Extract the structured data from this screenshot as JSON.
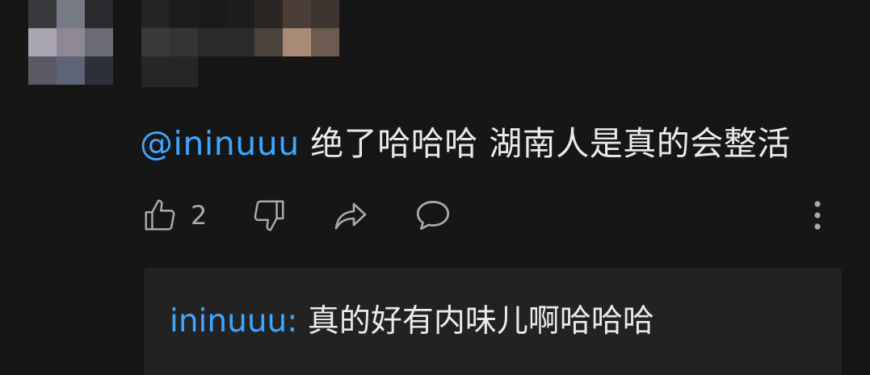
{
  "comment": {
    "author_mosaic": "blurred",
    "mention": "@ininuuu",
    "text": "绝了哈哈哈 湖南人是真的会整活",
    "likes": "2",
    "icons": {
      "like": "thumbs-up-icon",
      "dislike": "thumbs-down-icon",
      "share": "share-icon",
      "reply": "reply-bubble-icon",
      "more": "more-vertical-icon"
    }
  },
  "reply_preview": {
    "author": "ininuuu:",
    "text": "真的好有内味儿啊哈哈哈"
  },
  "colors": {
    "background": "#161616",
    "mention": "#3ea6ff",
    "text": "#eaeaea",
    "icon": "#aaaaaa",
    "reply_bg": "#222222"
  }
}
